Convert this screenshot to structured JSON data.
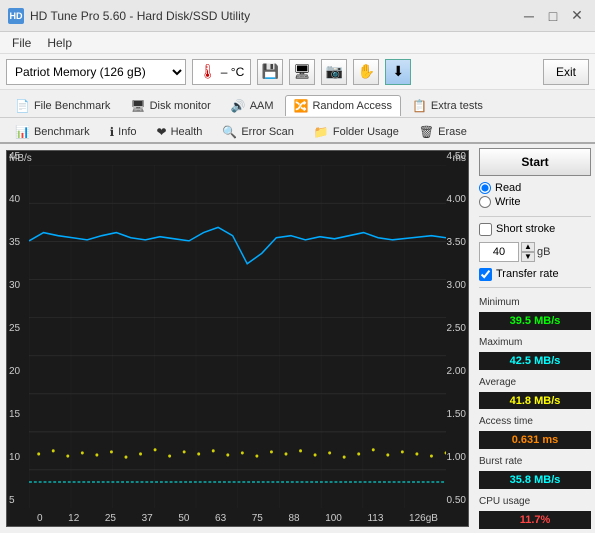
{
  "titleBar": {
    "icon": "HD",
    "title": "HD Tune Pro 5.60 - Hard Disk/SSD Utility",
    "minimize": "─",
    "maximize": "□",
    "close": "✕"
  },
  "menuBar": {
    "items": [
      "File",
      "Help"
    ]
  },
  "toolbar": {
    "driveSelect": "Patriot Memory (126 gB)",
    "tempLabel": "– °C",
    "buttons": [
      {
        "icon": "💾",
        "name": "info-btn"
      },
      {
        "icon": "🖥",
        "name": "disk-btn"
      },
      {
        "icon": "📷",
        "name": "screenshot-btn"
      },
      {
        "icon": "✋",
        "name": "hand-btn"
      },
      {
        "icon": "⬇",
        "name": "download-btn"
      }
    ],
    "exitLabel": "Exit"
  },
  "navTabs1": {
    "items": [
      {
        "label": "File Benchmark",
        "icon": "📄"
      },
      {
        "label": "Disk monitor",
        "icon": "🖥"
      },
      {
        "label": "AAM",
        "icon": "🔊"
      },
      {
        "label": "Random Access",
        "icon": "🔀",
        "active": true
      },
      {
        "label": "Extra tests",
        "icon": "📋"
      }
    ]
  },
  "navTabs2": {
    "items": [
      {
        "label": "Benchmark",
        "icon": "📊"
      },
      {
        "label": "Info",
        "icon": "ℹ"
      },
      {
        "label": "Health",
        "icon": "❤"
      },
      {
        "label": "Error Scan",
        "icon": "🔍"
      },
      {
        "label": "Folder Usage",
        "icon": "📁"
      },
      {
        "label": "Erase",
        "icon": "🗑"
      }
    ]
  },
  "rightPanel": {
    "startLabel": "Start",
    "radioOptions": [
      "Read",
      "Write"
    ],
    "selectedRadio": "Read",
    "shortStrokeLabel": "Short stroke",
    "shortStrokeValue": "40",
    "shortStrokeUnit": "gB",
    "transferRateLabel": "Transfer rate",
    "transferRateChecked": true,
    "stats": {
      "minimumLabel": "Minimum",
      "minimumValue": "39.5 MB/s",
      "maximumLabel": "Maximum",
      "maximumValue": "42.5 MB/s",
      "averageLabel": "Average",
      "averageValue": "41.8 MB/s",
      "accessTimeLabel": "Access time",
      "accessTimeValue": "0.631 ms",
      "burstRateLabel": "Burst rate",
      "burstRateValue": "35.8 MB/s",
      "cpuUsageLabel": "CPU usage",
      "cpuUsageValue": "11.7%"
    }
  },
  "chart": {
    "yLabelsLeft": [
      "45",
      "40",
      "35",
      "30",
      "25",
      "20",
      "15",
      "10",
      "5"
    ],
    "yLabelsRight": [
      "4.50",
      "4.00",
      "3.50",
      "3.00",
      "2.50",
      "2.00",
      "1.50",
      "1.00",
      "0.50"
    ],
    "xLabels": [
      "0",
      "12",
      "25",
      "37",
      "50",
      "63",
      "75",
      "88",
      "100",
      "113",
      "126gB"
    ],
    "unitLeft": "MB/s",
    "unitRight": "ms"
  }
}
